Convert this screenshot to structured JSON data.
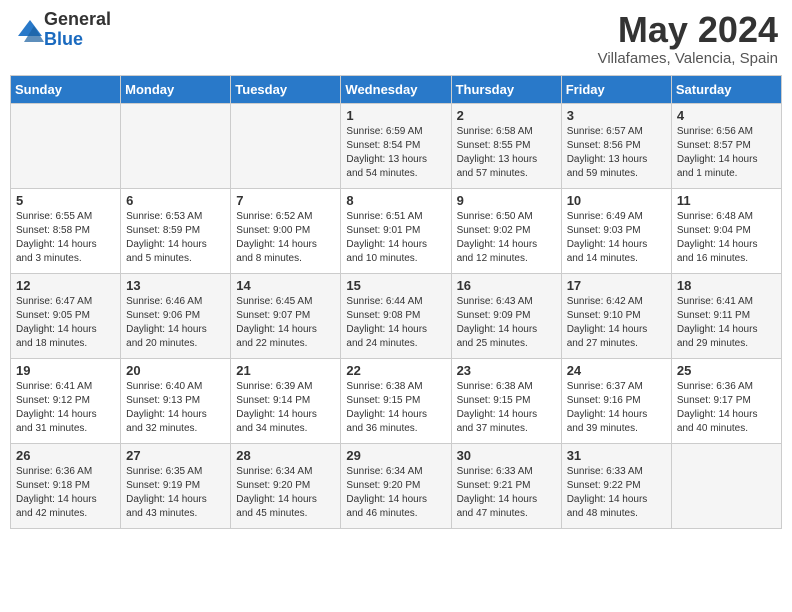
{
  "header": {
    "logo_general": "General",
    "logo_blue": "Blue",
    "month_year": "May 2024",
    "location": "Villafames, Valencia, Spain"
  },
  "weekdays": [
    "Sunday",
    "Monday",
    "Tuesday",
    "Wednesday",
    "Thursday",
    "Friday",
    "Saturday"
  ],
  "weeks": [
    [
      {
        "day": "",
        "info": ""
      },
      {
        "day": "",
        "info": ""
      },
      {
        "day": "",
        "info": ""
      },
      {
        "day": "1",
        "info": "Sunrise: 6:59 AM\nSunset: 8:54 PM\nDaylight: 13 hours\nand 54 minutes."
      },
      {
        "day": "2",
        "info": "Sunrise: 6:58 AM\nSunset: 8:55 PM\nDaylight: 13 hours\nand 57 minutes."
      },
      {
        "day": "3",
        "info": "Sunrise: 6:57 AM\nSunset: 8:56 PM\nDaylight: 13 hours\nand 59 minutes."
      },
      {
        "day": "4",
        "info": "Sunrise: 6:56 AM\nSunset: 8:57 PM\nDaylight: 14 hours\nand 1 minute."
      }
    ],
    [
      {
        "day": "5",
        "info": "Sunrise: 6:55 AM\nSunset: 8:58 PM\nDaylight: 14 hours\nand 3 minutes."
      },
      {
        "day": "6",
        "info": "Sunrise: 6:53 AM\nSunset: 8:59 PM\nDaylight: 14 hours\nand 5 minutes."
      },
      {
        "day": "7",
        "info": "Sunrise: 6:52 AM\nSunset: 9:00 PM\nDaylight: 14 hours\nand 8 minutes."
      },
      {
        "day": "8",
        "info": "Sunrise: 6:51 AM\nSunset: 9:01 PM\nDaylight: 14 hours\nand 10 minutes."
      },
      {
        "day": "9",
        "info": "Sunrise: 6:50 AM\nSunset: 9:02 PM\nDaylight: 14 hours\nand 12 minutes."
      },
      {
        "day": "10",
        "info": "Sunrise: 6:49 AM\nSunset: 9:03 PM\nDaylight: 14 hours\nand 14 minutes."
      },
      {
        "day": "11",
        "info": "Sunrise: 6:48 AM\nSunset: 9:04 PM\nDaylight: 14 hours\nand 16 minutes."
      }
    ],
    [
      {
        "day": "12",
        "info": "Sunrise: 6:47 AM\nSunset: 9:05 PM\nDaylight: 14 hours\nand 18 minutes."
      },
      {
        "day": "13",
        "info": "Sunrise: 6:46 AM\nSunset: 9:06 PM\nDaylight: 14 hours\nand 20 minutes."
      },
      {
        "day": "14",
        "info": "Sunrise: 6:45 AM\nSunset: 9:07 PM\nDaylight: 14 hours\nand 22 minutes."
      },
      {
        "day": "15",
        "info": "Sunrise: 6:44 AM\nSunset: 9:08 PM\nDaylight: 14 hours\nand 24 minutes."
      },
      {
        "day": "16",
        "info": "Sunrise: 6:43 AM\nSunset: 9:09 PM\nDaylight: 14 hours\nand 25 minutes."
      },
      {
        "day": "17",
        "info": "Sunrise: 6:42 AM\nSunset: 9:10 PM\nDaylight: 14 hours\nand 27 minutes."
      },
      {
        "day": "18",
        "info": "Sunrise: 6:41 AM\nSunset: 9:11 PM\nDaylight: 14 hours\nand 29 minutes."
      }
    ],
    [
      {
        "day": "19",
        "info": "Sunrise: 6:41 AM\nSunset: 9:12 PM\nDaylight: 14 hours\nand 31 minutes."
      },
      {
        "day": "20",
        "info": "Sunrise: 6:40 AM\nSunset: 9:13 PM\nDaylight: 14 hours\nand 32 minutes."
      },
      {
        "day": "21",
        "info": "Sunrise: 6:39 AM\nSunset: 9:14 PM\nDaylight: 14 hours\nand 34 minutes."
      },
      {
        "day": "22",
        "info": "Sunrise: 6:38 AM\nSunset: 9:15 PM\nDaylight: 14 hours\nand 36 minutes."
      },
      {
        "day": "23",
        "info": "Sunrise: 6:38 AM\nSunset: 9:15 PM\nDaylight: 14 hours\nand 37 minutes."
      },
      {
        "day": "24",
        "info": "Sunrise: 6:37 AM\nSunset: 9:16 PM\nDaylight: 14 hours\nand 39 minutes."
      },
      {
        "day": "25",
        "info": "Sunrise: 6:36 AM\nSunset: 9:17 PM\nDaylight: 14 hours\nand 40 minutes."
      }
    ],
    [
      {
        "day": "26",
        "info": "Sunrise: 6:36 AM\nSunset: 9:18 PM\nDaylight: 14 hours\nand 42 minutes."
      },
      {
        "day": "27",
        "info": "Sunrise: 6:35 AM\nSunset: 9:19 PM\nDaylight: 14 hours\nand 43 minutes."
      },
      {
        "day": "28",
        "info": "Sunrise: 6:34 AM\nSunset: 9:20 PM\nDaylight: 14 hours\nand 45 minutes."
      },
      {
        "day": "29",
        "info": "Sunrise: 6:34 AM\nSunset: 9:20 PM\nDaylight: 14 hours\nand 46 minutes."
      },
      {
        "day": "30",
        "info": "Sunrise: 6:33 AM\nSunset: 9:21 PM\nDaylight: 14 hours\nand 47 minutes."
      },
      {
        "day": "31",
        "info": "Sunrise: 6:33 AM\nSunset: 9:22 PM\nDaylight: 14 hours\nand 48 minutes."
      },
      {
        "day": "",
        "info": ""
      }
    ]
  ]
}
